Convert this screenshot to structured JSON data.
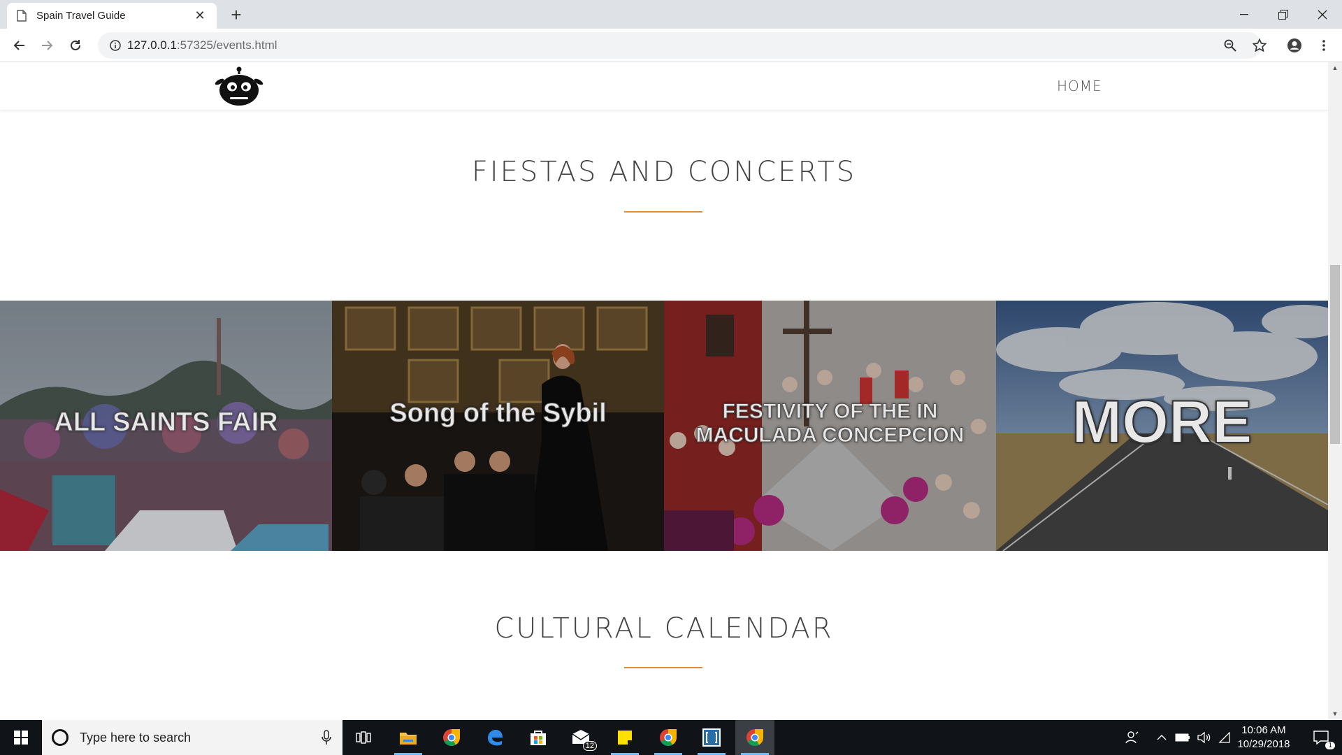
{
  "browser": {
    "tab_title": "Spain Travel Guide",
    "url_host": "127.0.0.1",
    "url_rest": ":57325/events.html"
  },
  "site": {
    "nav_home": "HOME"
  },
  "sections": {
    "fiestas_title": "FIESTAS AND CONCERTS",
    "calendar_title": "CULTURAL CALENDAR"
  },
  "tiles": [
    {
      "label": "ALL SAINTS FAIR"
    },
    {
      "label": "Song of the Sybil"
    },
    {
      "label_line1": "FESTIVITY OF THE IN",
      "label_line2": "MACULADA CONCEPCION"
    },
    {
      "label": "MORE"
    }
  ],
  "taskbar": {
    "search_placeholder": "Type here to search",
    "mail_badge": "12",
    "time": "10:06 AM",
    "date": "10/29/2018",
    "notification_count": "1"
  },
  "colors": {
    "accent_underline": "#e08a3c",
    "taskbar_bg": "#101418",
    "tabbar_bg": "#dee1e6"
  }
}
